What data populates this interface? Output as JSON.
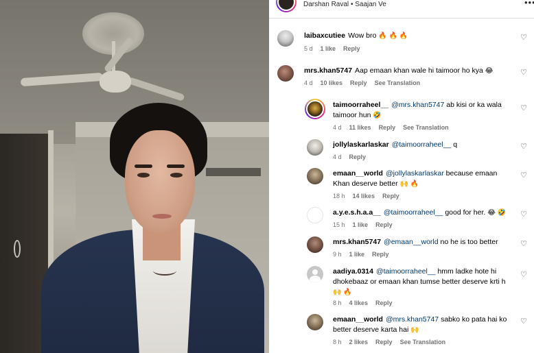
{
  "post": {
    "author": "Darshan Raval",
    "separator": "•",
    "audio": "Saajan Ve"
  },
  "colors": {
    "mention": "#00376b",
    "meta": "#737373",
    "divider": "#dbdbdb"
  },
  "comments": [
    {
      "user": "laibaxcutiee",
      "mention": "",
      "text": "Wow bro",
      "emoji": "🔥 🔥 🔥",
      "time": "5 d",
      "likes": "1 like",
      "reply": "Reply",
      "translate": ""
    },
    {
      "user": "mrs.khan5747",
      "mention": "",
      "text": "Aap emaan khan wale hi taimoor ho kya",
      "emoji": "😂",
      "time": "4 d",
      "likes": "10 likes",
      "reply": "Reply",
      "translate": "See Translation"
    },
    {
      "user": "taimoorraheel__",
      "mention": "@mrs.khan5747",
      "text": "ab kisi or ka wala taimoor hun",
      "emoji": "🤣",
      "time": "4 d",
      "likes": "11 likes",
      "reply": "Reply",
      "translate": "See Translation"
    },
    {
      "user": "jollylaskarlaskar",
      "mention": "@taimoorraheel__",
      "text": "q",
      "emoji": "",
      "time": "4 d",
      "likes": "",
      "reply": "Reply",
      "translate": ""
    },
    {
      "user": "emaan__world",
      "mention": "@jollylaskarlaskar",
      "text": "because emaan Khan deserve better",
      "emoji": "🙌 🔥",
      "time": "18 h",
      "likes": "14 likes",
      "reply": "Reply",
      "translate": ""
    },
    {
      "user": "a.y.e.s.h.a.a__",
      "mention": "@taimoorraheel__",
      "text": "good for her.",
      "emoji": "😂 🤣",
      "time": "15 h",
      "likes": "1 like",
      "reply": "Reply",
      "translate": ""
    },
    {
      "user": "mrs.khan5747",
      "mention": "@emaan__world",
      "text": "no he is too better",
      "emoji": "",
      "time": "9 h",
      "likes": "1 like",
      "reply": "Reply",
      "translate": ""
    },
    {
      "user": "aadiya.0314",
      "mention": "@taimoorraheel__",
      "text": "hmm ladke hote hi dhokebaaz or emaan khan tumse better deserve krti h",
      "emoji": "🙌 🔥",
      "time": "8 h",
      "likes": "4 likes",
      "reply": "Reply",
      "translate": ""
    },
    {
      "user": "emaan__world",
      "mention": "@mrs.khan5747",
      "text": "sabko ko pata hai ko better deserve karta hai",
      "emoji": "🙌",
      "time": "8 h",
      "likes": "2 likes",
      "reply": "Reply",
      "translate": "See Translation"
    }
  ],
  "icons": {
    "heart": "♡",
    "more": "•••"
  }
}
